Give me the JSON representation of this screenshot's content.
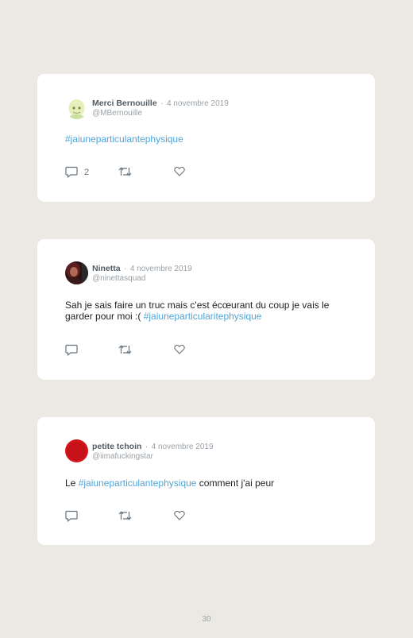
{
  "tweets": [
    {
      "author": "Merci Bernouille",
      "separator": "·",
      "date": "4 novembre 2019",
      "handle": "@MBernouille",
      "text_before": "",
      "hashtag": "#jaiuneparticulantephysique",
      "text_after": "",
      "reply_count": "2",
      "avatar_icon": "pearl-cartoon-avatar",
      "avatar_color": "#e7efb8"
    },
    {
      "author": "Ninetta",
      "separator": "·",
      "date": "4 novembre 2019",
      "handle": "@ninettasquad",
      "text_before": "Sah je sais faire un truc mais c'est écœurant du coup je vais le garder pour moi :( ",
      "hashtag": "#jaiuneparticularitephysique",
      "text_after": "",
      "reply_count": "",
      "avatar_icon": "portrait-photo-avatar",
      "avatar_color": "#5a2020"
    },
    {
      "author": "petite tchoin",
      "separator": "·",
      "date": "4 novembre 2019",
      "handle": "@iimafuckingstar",
      "text_before": "Le ",
      "hashtag": "#jaiuneparticulantephysique",
      "text_after": " comment j'ai peur",
      "reply_count": "",
      "avatar_icon": "red-avatar",
      "avatar_color": "#d2161b"
    }
  ],
  "page_number": "30",
  "colors": {
    "background": "#ece9e4",
    "card": "#ffffff",
    "hashtag": "#4fa5d9",
    "muted": "#9aa1a7"
  }
}
